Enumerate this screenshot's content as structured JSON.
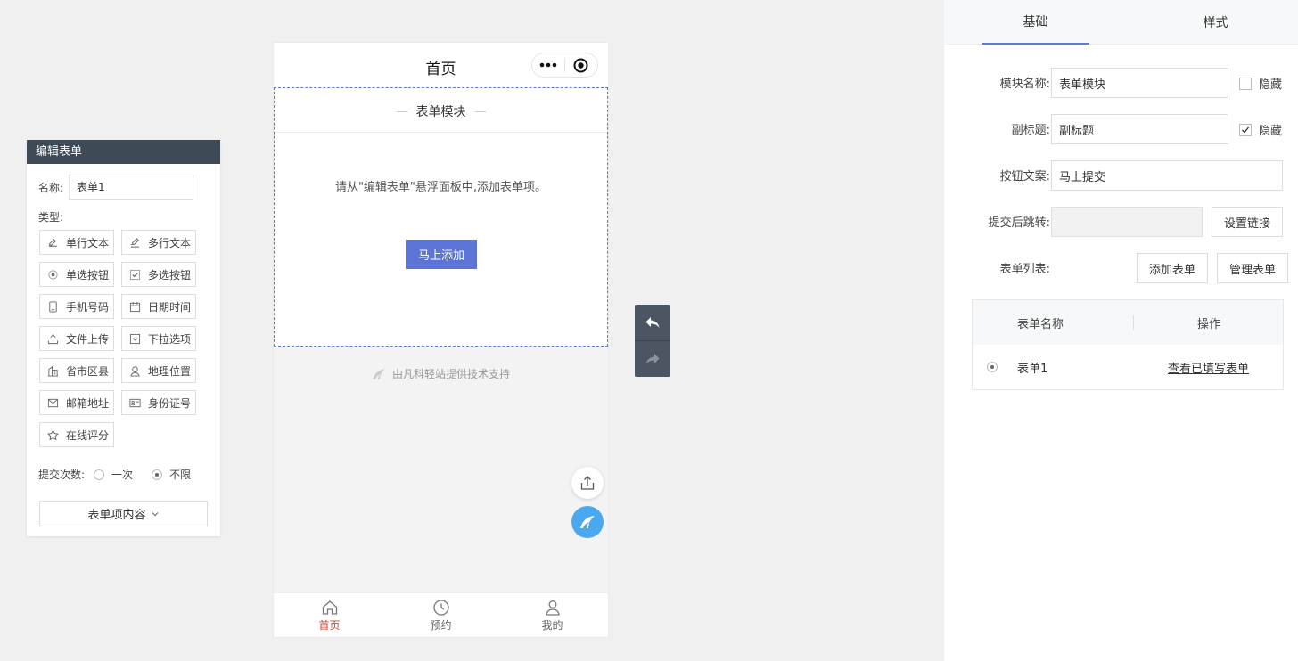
{
  "edit_panel": {
    "title": "编辑表单",
    "name_label": "名称:",
    "name_value": "表单1",
    "type_label": "类型:",
    "types": [
      {
        "label": "单行文本",
        "icon": "single-line-text-icon"
      },
      {
        "label": "多行文本",
        "icon": "multi-line-text-icon"
      },
      {
        "label": "单选按钮",
        "icon": "radio-icon"
      },
      {
        "label": "多选按钮",
        "icon": "checkbox-icon"
      },
      {
        "label": "手机号码",
        "icon": "phone-icon"
      },
      {
        "label": "日期时间",
        "icon": "calendar-icon"
      },
      {
        "label": "文件上传",
        "icon": "upload-icon"
      },
      {
        "label": "下拉选项",
        "icon": "dropdown-icon"
      },
      {
        "label": "省市区县",
        "icon": "building-icon"
      },
      {
        "label": "地理位置",
        "icon": "location-icon"
      },
      {
        "label": "邮箱地址",
        "icon": "mail-icon"
      },
      {
        "label": "身份证号",
        "icon": "id-card-icon"
      },
      {
        "label": "在线评分",
        "icon": "star-icon"
      }
    ],
    "submit_count_label": "提交次数:",
    "submit_options": [
      {
        "label": "一次",
        "selected": false
      },
      {
        "label": "不限",
        "selected": true
      }
    ],
    "items_button": "表单项内容"
  },
  "phone": {
    "page_title": "首页",
    "module_title": "表单模块",
    "hint": "请从\"编辑表单\"悬浮面板中,添加表单项。",
    "add_button": "马上添加",
    "support_text": "由凡科轻站提供技术支持",
    "tabs": [
      {
        "label": "首页",
        "icon": "home-icon",
        "active": true
      },
      {
        "label": "预约",
        "icon": "clock-icon",
        "active": false
      },
      {
        "label": "我的",
        "icon": "user-icon",
        "active": false
      }
    ]
  },
  "settings": {
    "tabs": [
      {
        "label": "基础",
        "active": true
      },
      {
        "label": "样式",
        "active": false
      }
    ],
    "module_name_label": "模块名称:",
    "module_name_value": "表单模块",
    "hide_label": "隐藏",
    "module_name_hidden": false,
    "subtitle_label": "副标题:",
    "subtitle_value": "副标题",
    "subtitle_hidden": true,
    "button_text_label": "按钮文案:",
    "button_text_value": "马上提交",
    "redirect_label": "提交后跳转:",
    "redirect_value": "",
    "set_link_button": "设置链接",
    "form_list_label": "表单列表:",
    "add_form_button": "添加表单",
    "manage_form_button": "管理表单",
    "table": {
      "headers": [
        "表单名称",
        "操作"
      ],
      "rows": [
        {
          "name": "表单1",
          "action": "查看已填写表单",
          "selected": true
        }
      ]
    }
  },
  "colors": {
    "accent": "#5b74d6",
    "panel_header": "#3e4a56",
    "active_tab": "#c8472f",
    "logo_blue": "#4aa8ef"
  }
}
